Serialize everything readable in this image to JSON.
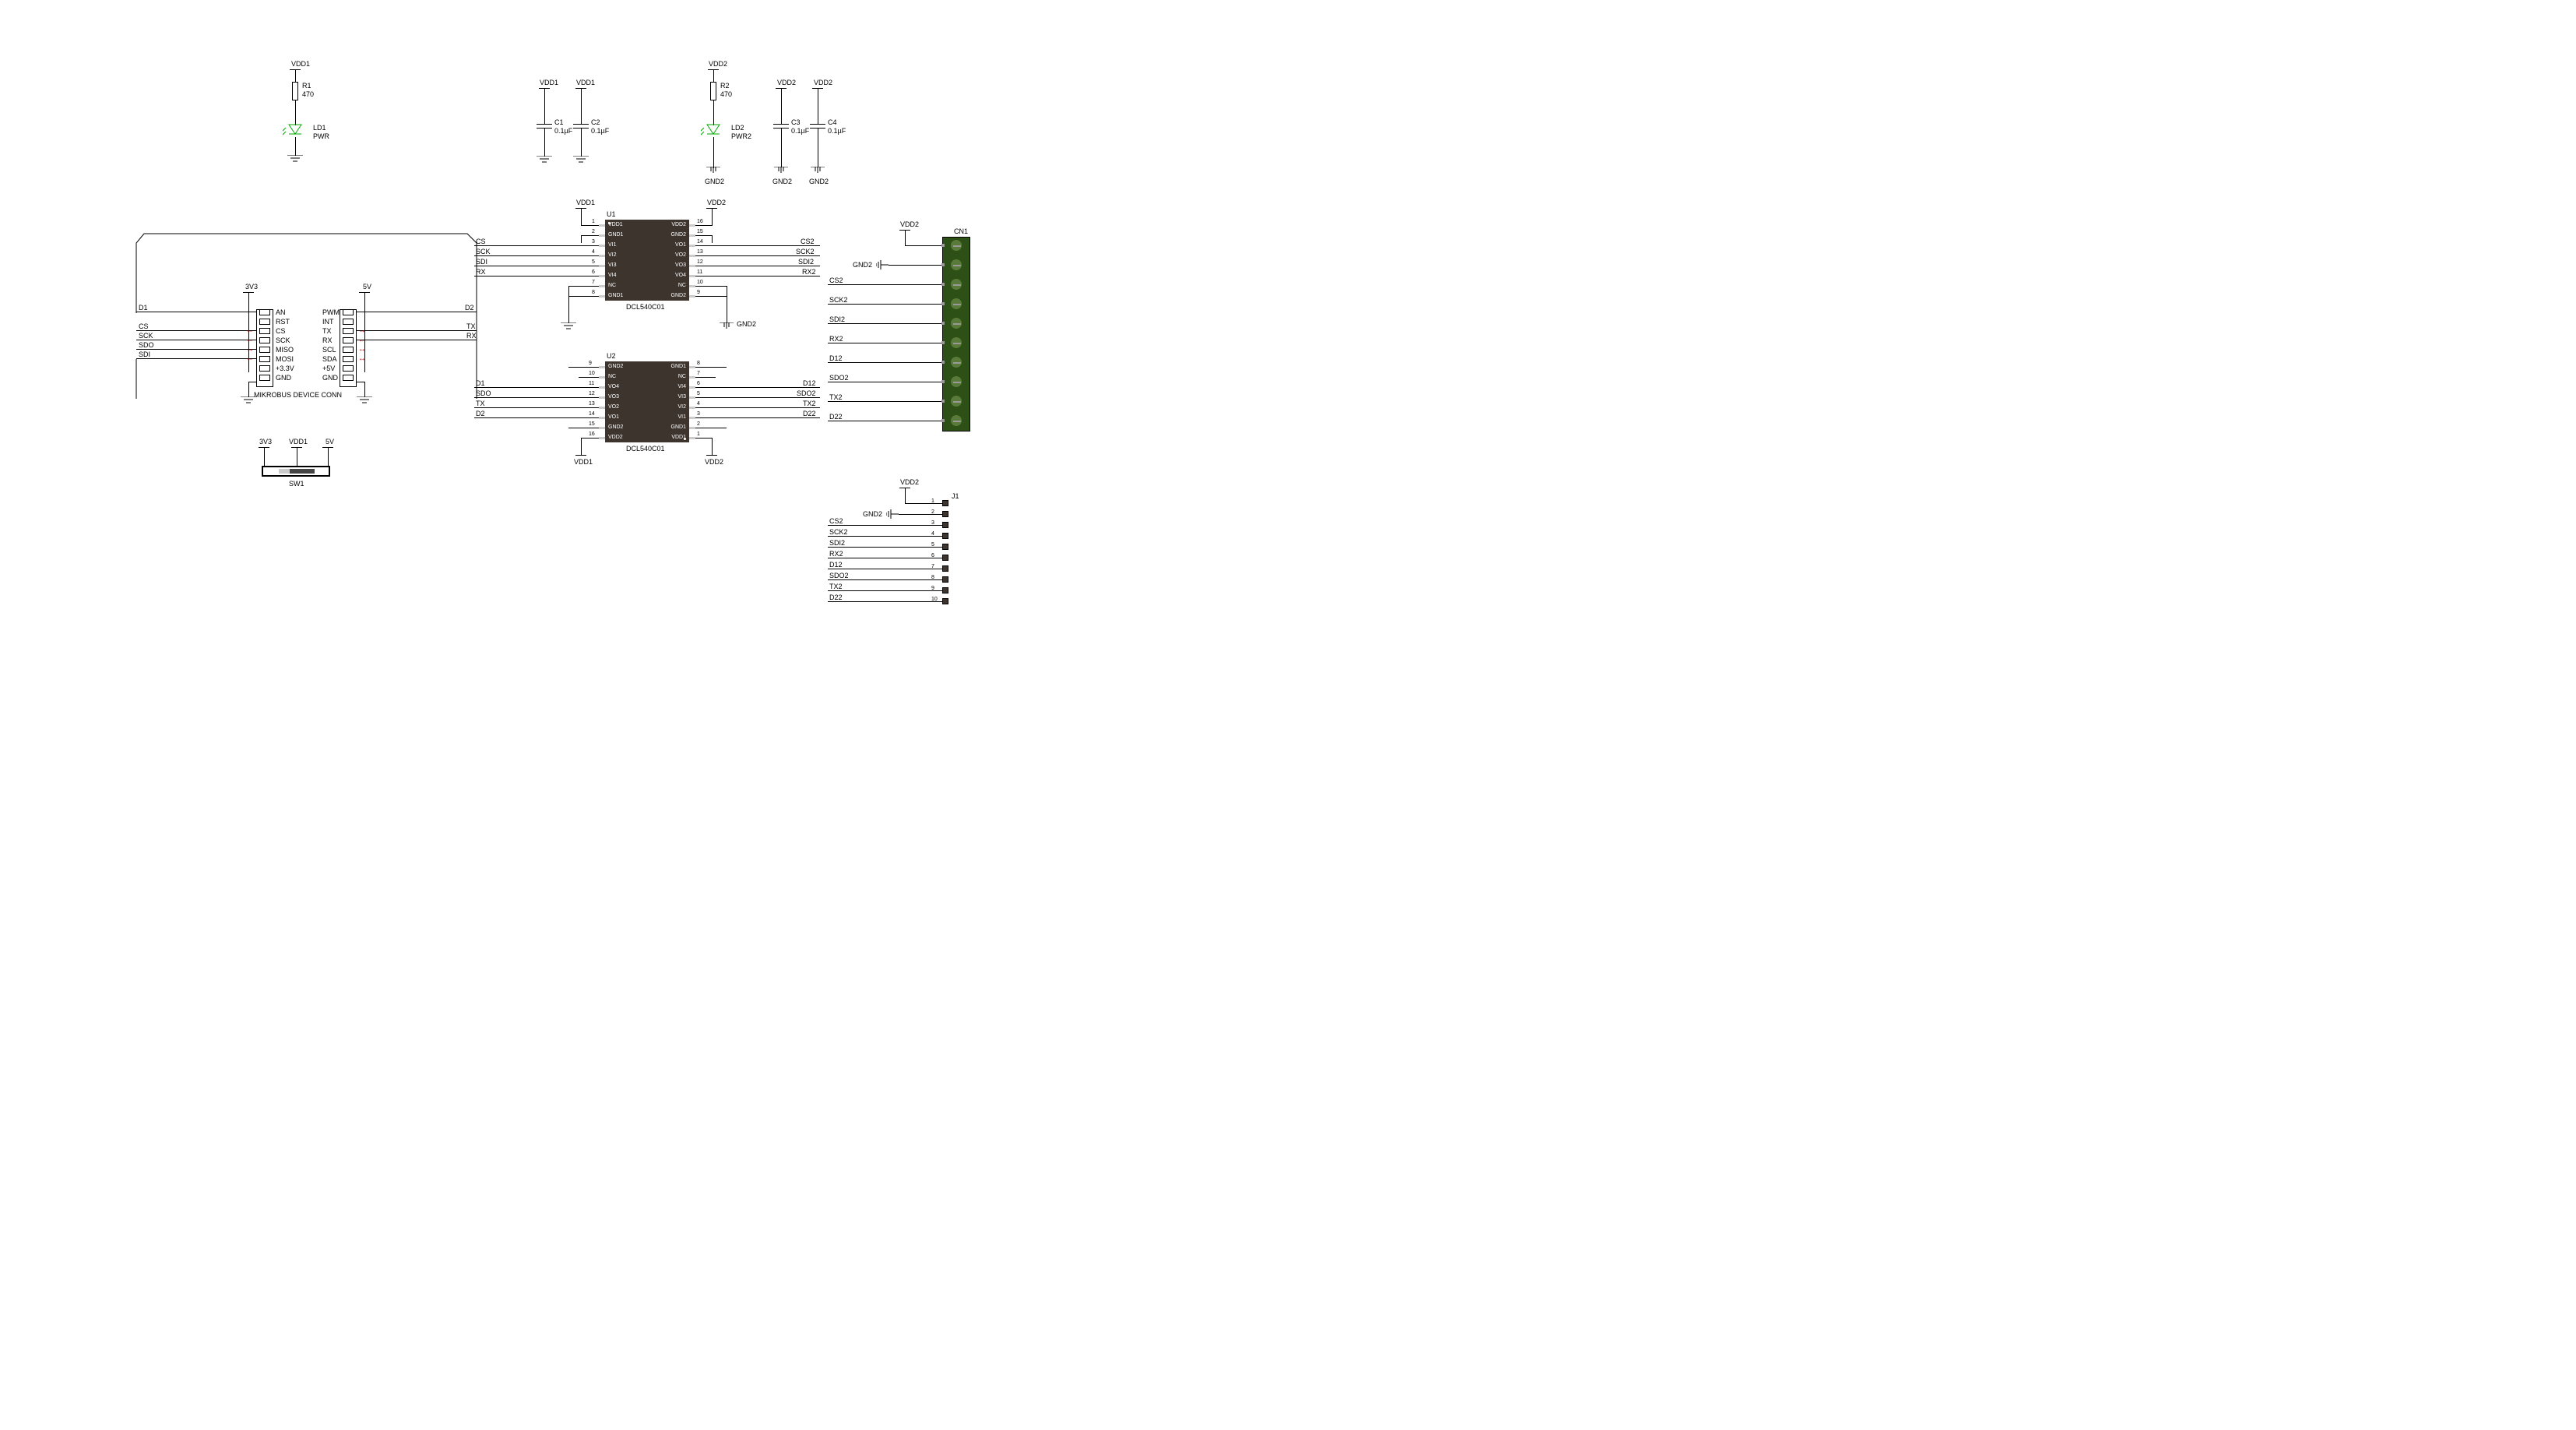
{
  "power": {
    "vdd1": "VDD1",
    "vdd2": "VDD2",
    "gnd2": "GND2",
    "3v3": "3V3",
    "5v": "5V"
  },
  "r1": {
    "ref": "R1",
    "val": "470"
  },
  "r2": {
    "ref": "R2",
    "val": "470"
  },
  "ld1": {
    "ref": "LD1",
    "name": "PWR"
  },
  "ld2": {
    "ref": "LD2",
    "name": "PWR2"
  },
  "c1": {
    "ref": "C1",
    "val": "0.1µF"
  },
  "c2": {
    "ref": "C2",
    "val": "0.1µF"
  },
  "c3": {
    "ref": "C3",
    "val": "0.1µF"
  },
  "c4": {
    "ref": "C4",
    "val": "0.1µF"
  },
  "u1": {
    "ref": "U1",
    "part": "DCL540C01",
    "pins_left": [
      "VDD1",
      "GND1",
      "VI1",
      "VI2",
      "VI3",
      "VI4",
      "NC",
      "GND1"
    ],
    "pins_right": [
      "VDD2",
      "GND2",
      "VO1",
      "VO2",
      "VO3",
      "VO4",
      "NC",
      "GND2"
    ],
    "nums_left": [
      "1",
      "2",
      "3",
      "4",
      "5",
      "6",
      "7",
      "8"
    ],
    "nums_right": [
      "16",
      "15",
      "14",
      "13",
      "12",
      "11",
      "10",
      "9"
    ]
  },
  "u2": {
    "ref": "U2",
    "part": "DCL540C01",
    "pins_left": [
      "GND2",
      "NC",
      "VO4",
      "VO3",
      "VO2",
      "VO1",
      "GND2",
      "VDD2"
    ],
    "pins_right": [
      "GND1",
      "NC",
      "VI4",
      "VI3",
      "VI2",
      "VI1",
      "GND1",
      "VDD1"
    ],
    "nums_left": [
      "9",
      "10",
      "11",
      "12",
      "13",
      "14",
      "15",
      "16"
    ],
    "nums_right": [
      "8",
      "7",
      "6",
      "5",
      "4",
      "3",
      "2",
      "1"
    ]
  },
  "mikrobus": {
    "title": "MIKROBUS DEVICE CONN",
    "left": [
      "AN",
      "RST",
      "CS",
      "SCK",
      "MISO",
      "MOSI",
      "+3.3V",
      "GND"
    ],
    "right": [
      "PWM",
      "INT",
      "TX",
      "RX",
      "SCL",
      "SDA",
      "+5V",
      "GND"
    ]
  },
  "nets_mb_left": [
    "D1",
    "CS",
    "SCK",
    "SDO",
    "SDI"
  ],
  "nets_mb_right": [
    "D2",
    "TX",
    "RX"
  ],
  "nets_u1_left": [
    "CS",
    "SCK",
    "SDI",
    "RX"
  ],
  "nets_u1_right": [
    "CS2",
    "SCK2",
    "SDI2",
    "RX2"
  ],
  "nets_u2_left": [
    "D1",
    "SDO",
    "TX",
    "D2"
  ],
  "nets_u2_right": [
    "D12",
    "SDO2",
    "TX2",
    "D22"
  ],
  "cn1": {
    "ref": "CN1",
    "labels": [
      "CS2",
      "SCK2",
      "SDI2",
      "RX2",
      "D12",
      "SDO2",
      "TX2",
      "D22"
    ]
  },
  "j1": {
    "ref": "J1",
    "nums": [
      "1",
      "2",
      "3",
      "4",
      "5",
      "6",
      "7",
      "8",
      "9",
      "10"
    ],
    "labels": [
      "CS2",
      "SCK2",
      "SDI2",
      "RX2",
      "D12",
      "SDO2",
      "TX2",
      "D22"
    ]
  },
  "sw1": {
    "ref": "SW1"
  }
}
